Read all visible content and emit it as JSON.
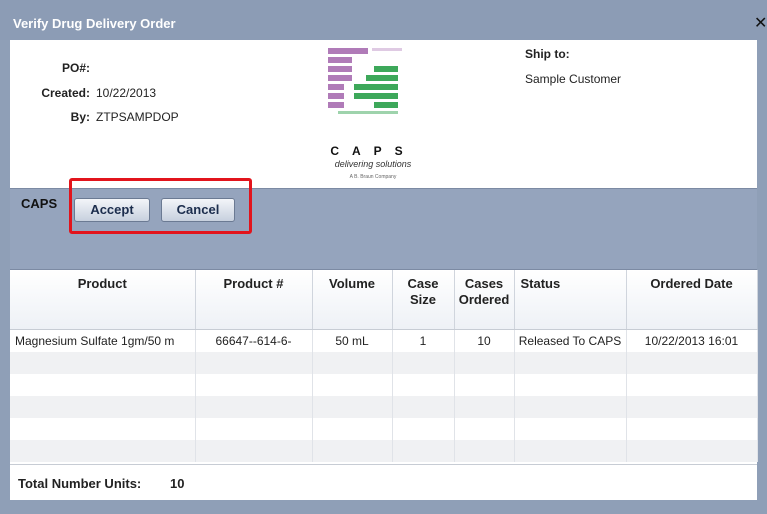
{
  "window": {
    "title": "Verify Drug Delivery Order",
    "close_symbol": "✕"
  },
  "order": {
    "po_label": "PO#:",
    "po_value": "",
    "created_label": "Created:",
    "created_value": "10/22/2013",
    "by_label": "By:",
    "by_value": "ZTPSAMPDOP"
  },
  "ship_to": {
    "label": "Ship to:",
    "value": "Sample Customer"
  },
  "logo": {
    "word": "CAPS",
    "trademark": "®",
    "tagline": "delivering solutions",
    "sub": "A B. Braun Company",
    "colors": {
      "purple": "#b07bb8",
      "green": "#3da85a"
    }
  },
  "actions": {
    "label": "CAPS",
    "accept": "Accept",
    "cancel": "Cancel"
  },
  "table": {
    "columns": [
      "Product",
      "Product #",
      "Volume",
      "Case Size",
      "Cases Ordered",
      "Status",
      "Ordered Date"
    ],
    "rows": [
      [
        "Magnesium Sulfate 1gm/50 m",
        "66647--614-6-",
        "50 mL",
        "1",
        "10",
        "Released To CAPS",
        "10/22/2013 16:01"
      ]
    ]
  },
  "totals": {
    "label": "Total Number Units:",
    "value": "10"
  },
  "colors": {
    "highlight": "#e2141c",
    "accent": "#8c9cb5"
  }
}
